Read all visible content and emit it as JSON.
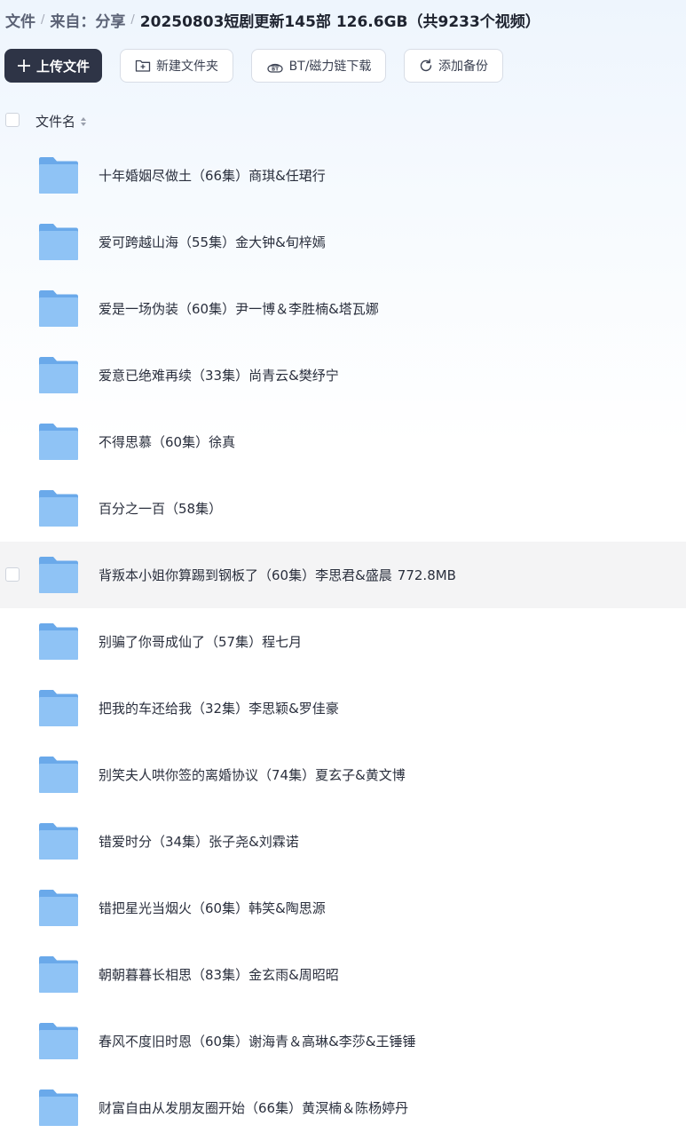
{
  "breadcrumb": {
    "items": [
      "文件",
      "来自：分享"
    ],
    "separator": "/",
    "current": "20250803短剧更新145部 126.6GB（共9233个视频）"
  },
  "toolbar": {
    "upload_label": "上传文件",
    "new_folder_label": "新建文件夹",
    "bt_label": "BT/磁力链下载",
    "backup_label": "添加备份"
  },
  "list": {
    "column_name": "文件名",
    "files": [
      {
        "name": "十年婚姻尽做土（66集）商琪&任珺行",
        "size": ""
      },
      {
        "name": "爱可跨越山海（55集）金大钟&旬梓嫣",
        "size": ""
      },
      {
        "name": "爱是一场伪装（60集）尹一博＆李胜楠&塔瓦娜",
        "size": ""
      },
      {
        "name": "爱意已绝难再续（33集）尚青云&樊纾宁",
        "size": ""
      },
      {
        "name": "不得思慕（60集）徐真",
        "size": ""
      },
      {
        "name": "百分之一百（58集）",
        "size": ""
      },
      {
        "name": "背叛本小姐你算踢到钢板了（60集）李思君&盛晨",
        "size": "772.8MB"
      },
      {
        "name": "别骗了你哥成仙了（57集）程七月",
        "size": ""
      },
      {
        "name": "把我的车还给我（32集）李思颖&罗佳豪",
        "size": ""
      },
      {
        "name": "别笑夫人哄你签的离婚协议（74集）夏玄子&黄文博",
        "size": ""
      },
      {
        "name": "错爱时分（34集）张子尧&刘霖诺",
        "size": ""
      },
      {
        "name": "错把星光当烟火（60集）韩笑&陶思源",
        "size": ""
      },
      {
        "name": "朝朝暮暮长相思（83集）金玄雨&周昭昭",
        "size": ""
      },
      {
        "name": "春风不度旧时恩（60集）谢海青＆高琳&李莎&王锤锤",
        "size": ""
      },
      {
        "name": "财富自由从发朋友圈开始（66集）黄溟楠＆陈杨婷丹",
        "size": ""
      }
    ]
  },
  "colors": {
    "primary_button": "#2e3446",
    "folder": "#7db8f0",
    "hover_row": "#f4f4f5"
  }
}
